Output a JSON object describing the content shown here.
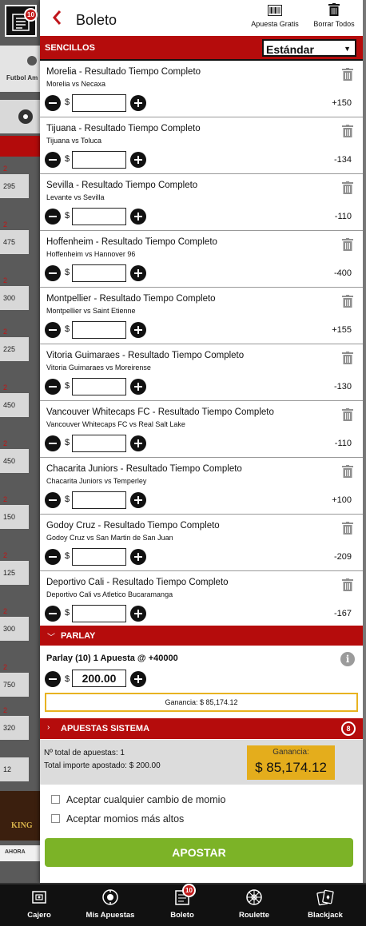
{
  "background": {
    "ticket_badge": "10",
    "sport_label": "Futbol Am",
    "red_marks": [
      "2",
      "2",
      "2",
      "2",
      "2",
      "2",
      "2",
      "2",
      "2",
      "2",
      "2"
    ],
    "values": [
      "295",
      "475",
      "300",
      "225",
      "450",
      "450",
      "150",
      "125",
      "300",
      "750",
      "320",
      "12"
    ],
    "promo_text": "KING",
    "ahora_label": "AHORA"
  },
  "header": {
    "title": "Boleto",
    "apuesta_gratis_label": "Apuesta Gratis",
    "borrar_todos_label": "Borrar Todos"
  },
  "sencillos": {
    "label": "SENCILLOS",
    "bet_type_selected": "Estándar"
  },
  "bets": [
    {
      "title": "Morelia - Resultado Tiempo Completo",
      "match": "Morelia vs Necaxa",
      "odds": "+150"
    },
    {
      "title": "Tijuana - Resultado Tiempo Completo",
      "match": "Tijuana vs Toluca",
      "odds": "-134"
    },
    {
      "title": "Sevilla - Resultado Tiempo Completo",
      "match": "Levante vs Sevilla",
      "odds": "-110"
    },
    {
      "title": "Hoffenheim - Resultado Tiempo Completo",
      "match": "Hoffenheim vs Hannover 96",
      "odds": "-400"
    },
    {
      "title": "Montpellier - Resultado Tiempo Completo",
      "match": "Montpellier vs Saint Etienne",
      "odds": "+155"
    },
    {
      "title": "Vitoria Guimaraes - Resultado Tiempo Completo",
      "match": "Vitoria Guimaraes vs Moreirense",
      "odds": "-130"
    },
    {
      "title": "Vancouver Whitecaps FC - Resultado Tiempo Completo",
      "match": "Vancouver Whitecaps FC vs Real Salt Lake",
      "odds": "-110"
    },
    {
      "title": "Chacarita Juniors - Resultado Tiempo Completo",
      "match": "Chacarita Juniors vs Temperley",
      "odds": "+100"
    },
    {
      "title": "Godoy Cruz - Resultado Tiempo Completo",
      "match": "Godoy Cruz vs San Martin de San Juan",
      "odds": "-209"
    },
    {
      "title": "Deportivo Cali - Resultado Tiempo Completo",
      "match": "Deportivo Cali vs Atletico Bucaramanga",
      "odds": "-167"
    }
  ],
  "currency_symbol": "$",
  "parlay": {
    "label": "PARLAY",
    "summary": "Parlay (10)   1 Apuesta @ +40000",
    "info_icon": "i",
    "amount": "200.00",
    "ganancia": "Ganancia: $ 85,174.12"
  },
  "sistema": {
    "label": "APUESTAS SISTEMA",
    "count": "8"
  },
  "summary": {
    "total_apuestas": "Nº total de apuestas: 1",
    "total_importe": "Total importe apostado: $ 200.00",
    "ganancia_label": "Ganancia:",
    "ganancia_value": "$ 85,174.12"
  },
  "options": {
    "accept_changes": "Aceptar cualquier cambio de momio",
    "accept_higher": "Aceptar momios más altos"
  },
  "apostar_label": "APOSTAR",
  "nav": {
    "items": [
      {
        "label": "Cajero",
        "icon": "cashier-icon"
      },
      {
        "label": "Mis Apuestas",
        "icon": "my-bets-icon"
      },
      {
        "label": "Boleto",
        "icon": "ticket-icon",
        "badge": "10"
      },
      {
        "label": "Roulette",
        "icon": "roulette-icon"
      },
      {
        "label": "Blackjack",
        "icon": "cards-icon"
      }
    ]
  },
  "colors": {
    "brand_red": "#b50c0c",
    "gold": "#e4ad1c",
    "apostar_green": "#7cb327"
  }
}
